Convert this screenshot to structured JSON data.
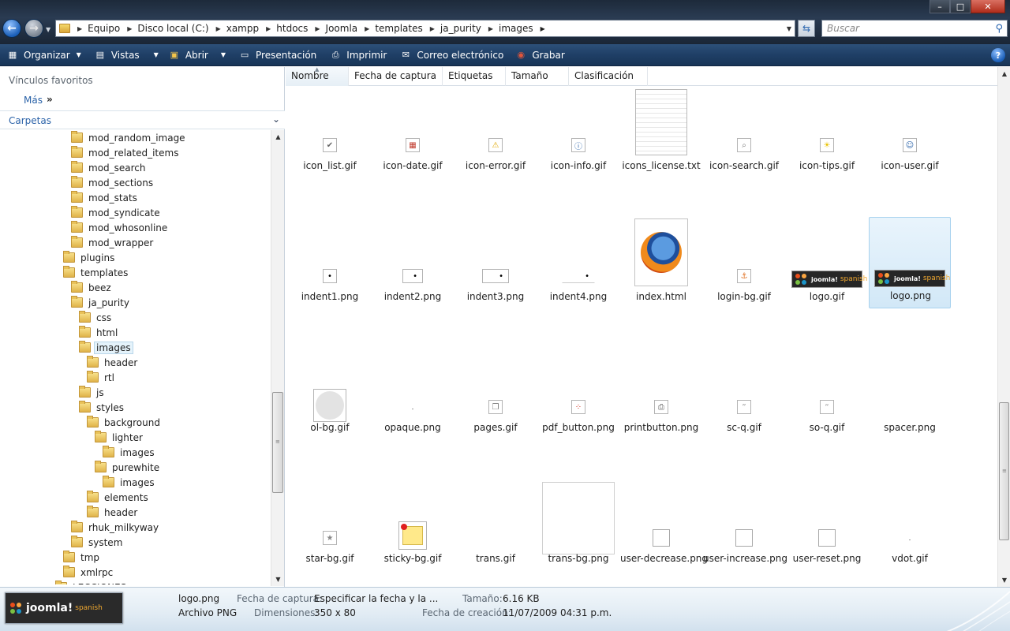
{
  "window": {
    "minimize": "–",
    "maximize": "□",
    "close": "✕"
  },
  "address": {
    "crumbs": [
      "Equipo",
      "Disco local (C:)",
      "xampp",
      "htdocs",
      "Joomla",
      "templates",
      "ja_purity",
      "images"
    ]
  },
  "search": {
    "placeholder": "Buscar"
  },
  "toolbar": {
    "organize": "Organizar",
    "views": "Vistas",
    "open": "Abrir",
    "slideshow": "Presentación",
    "print": "Imprimir",
    "email": "Correo electrónico",
    "burn": "Grabar",
    "help": "?"
  },
  "navpane": {
    "favorites_title": "Vínculos favoritos",
    "more": "Más",
    "more_arrow": "»",
    "folders_title": "Carpetas",
    "tree": [
      {
        "label": "mod_random_image",
        "level": 2
      },
      {
        "label": "mod_related_items",
        "level": 2
      },
      {
        "label": "mod_search",
        "level": 2
      },
      {
        "label": "mod_sections",
        "level": 2
      },
      {
        "label": "mod_stats",
        "level": 2
      },
      {
        "label": "mod_syndicate",
        "level": 2
      },
      {
        "label": "mod_whosonline",
        "level": 2
      },
      {
        "label": "mod_wrapper",
        "level": 2
      },
      {
        "label": "plugins",
        "level": 1
      },
      {
        "label": "templates",
        "level": 1
      },
      {
        "label": "beez",
        "level": 2
      },
      {
        "label": "ja_purity",
        "level": 2
      },
      {
        "label": "css",
        "level": 3
      },
      {
        "label": "html",
        "level": 3
      },
      {
        "label": "images",
        "level": 3,
        "selected": true
      },
      {
        "label": "header",
        "level": 4
      },
      {
        "label": "rtl",
        "level": 4
      },
      {
        "label": "js",
        "level": 3
      },
      {
        "label": "styles",
        "level": 3
      },
      {
        "label": "background",
        "level": 4
      },
      {
        "label": "lighter",
        "level": 5
      },
      {
        "label": "images",
        "level": 6
      },
      {
        "label": "purewhite",
        "level": 5
      },
      {
        "label": "images",
        "level": 6
      },
      {
        "label": "elements",
        "level": 4
      },
      {
        "label": "header",
        "level": 4
      },
      {
        "label": "rhuk_milkyway",
        "level": 2
      },
      {
        "label": "system",
        "level": 2
      },
      {
        "label": "tmp",
        "level": 1
      },
      {
        "label": "xmlrpc",
        "level": 1
      },
      {
        "label": "LECCIONES",
        "level": 0
      }
    ]
  },
  "columns": [
    "Nombre",
    "Fecha de captura",
    "Etiquetas",
    "Tamaño",
    "Clasificación"
  ],
  "files": [
    {
      "name": "icon_list.gif",
      "kind": "check"
    },
    {
      "name": "icon-date.gif",
      "kind": "date"
    },
    {
      "name": "icon-error.gif",
      "kind": "error"
    },
    {
      "name": "icon-info.gif",
      "kind": "info"
    },
    {
      "name": "icons_license.txt",
      "kind": "text"
    },
    {
      "name": "icon-search.gif",
      "kind": "search"
    },
    {
      "name": "icon-tips.gif",
      "kind": "tips"
    },
    {
      "name": "icon-user.gif",
      "kind": "user"
    },
    {
      "name": "indent1.png",
      "kind": "dot"
    },
    {
      "name": "indent2.png",
      "kind": "dot2"
    },
    {
      "name": "indent3.png",
      "kind": "dot3"
    },
    {
      "name": "indent4.png",
      "kind": "dot4"
    },
    {
      "name": "index.html",
      "kind": "firefox"
    },
    {
      "name": "login-bg.gif",
      "kind": "login"
    },
    {
      "name": "logo.gif",
      "kind": "logo"
    },
    {
      "name": "logo.png",
      "kind": "logo",
      "selected": true
    },
    {
      "name": "ol-bg.gif",
      "kind": "circle"
    },
    {
      "name": "opaque.png",
      "kind": "tiny"
    },
    {
      "name": "pages.gif",
      "kind": "pages"
    },
    {
      "name": "pdf_button.png",
      "kind": "pdf"
    },
    {
      "name": "printbutton.png",
      "kind": "printer"
    },
    {
      "name": "sc-q.gif",
      "kind": "quote"
    },
    {
      "name": "so-q.gif",
      "kind": "quote2"
    },
    {
      "name": "spacer.png",
      "kind": "none"
    },
    {
      "name": "star-bg.gif",
      "kind": "star"
    },
    {
      "name": "sticky-bg.gif",
      "kind": "sticky"
    },
    {
      "name": "trans.gif",
      "kind": "none"
    },
    {
      "name": "trans-bg.png",
      "kind": "blank"
    },
    {
      "name": "user-decrease.png",
      "kind": "box"
    },
    {
      "name": "user-increase.png",
      "kind": "box"
    },
    {
      "name": "user-reset.png",
      "kind": "box"
    },
    {
      "name": "vdot.gif",
      "kind": "tiny"
    }
  ],
  "logo": {
    "brand": "joomla!",
    "sub": "spanish"
  },
  "details": {
    "name": "logo.png",
    "type": "Archivo PNG",
    "date_taken_label": "Fecha de captura:",
    "date_taken_value": "Especificar la fecha y la ...",
    "dimensions_label": "Dimensiones:",
    "dimensions_value": "350 x 80",
    "size_label": "Tamaño:",
    "size_value": "6.16 KB",
    "created_label": "Fecha de creación:",
    "created_value": "11/07/2009 04:31 p.m."
  }
}
